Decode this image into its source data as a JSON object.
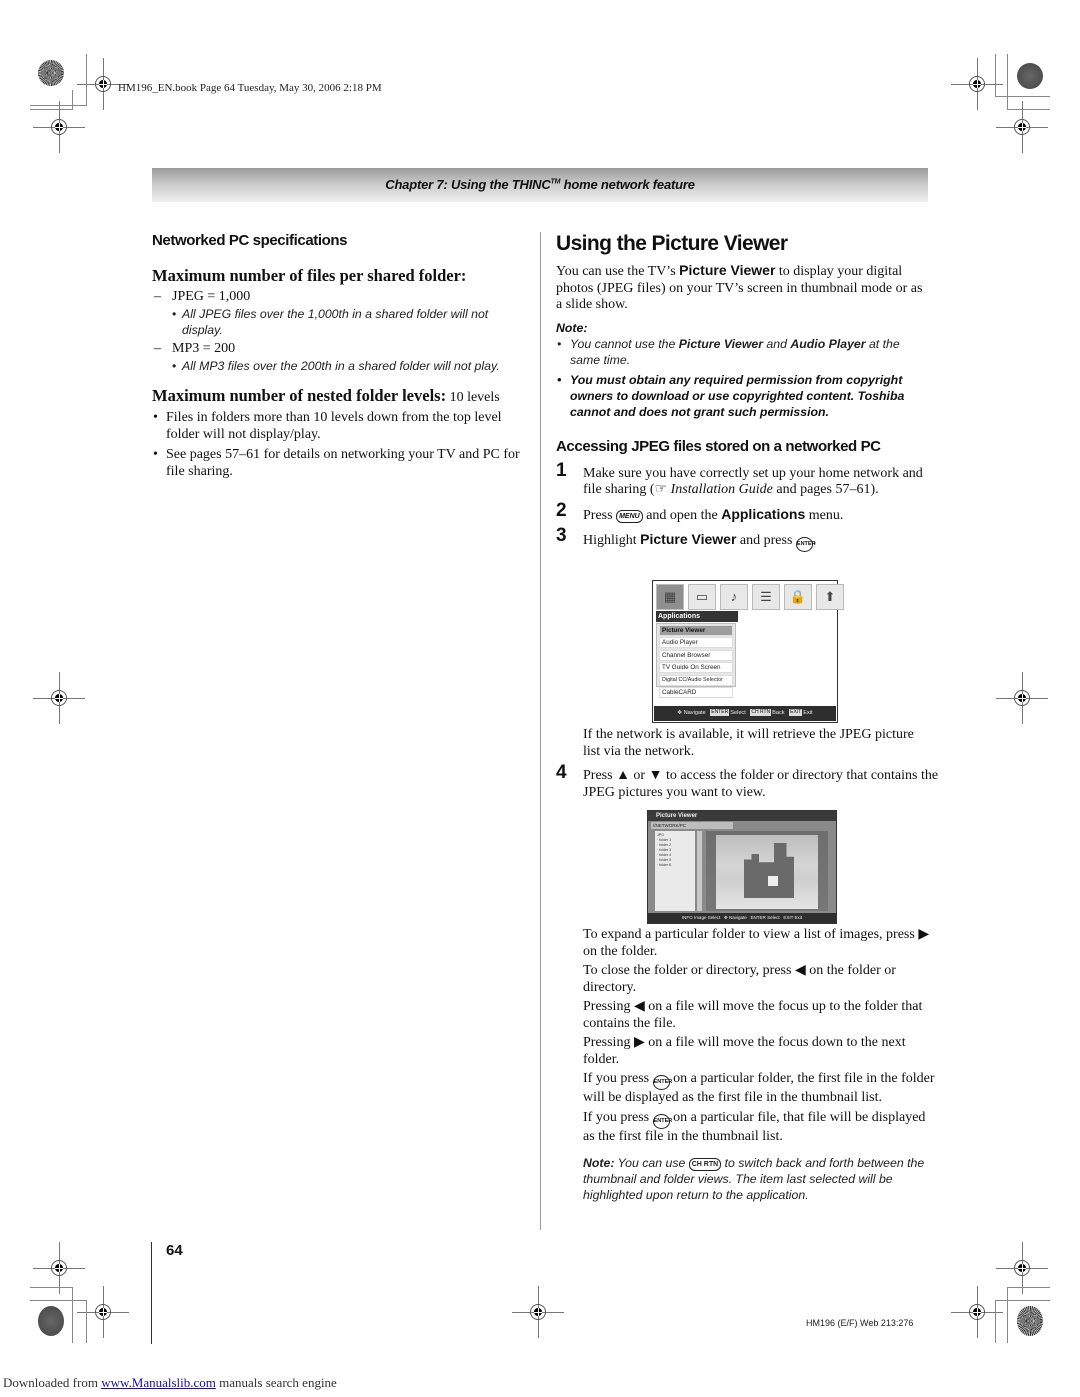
{
  "header": {
    "slug": "HM196_EN.book  Page 64  Tuesday, May 30, 2006  2:18 PM",
    "chapter_title": "Chapter 7: Using the THINC",
    "chapter_tm": "TM",
    "chapter_suffix": " home network feature"
  },
  "left": {
    "section_title": "Networked PC specifications",
    "files_heading": "Maximum number of files per shared folder:",
    "jpeg_line": "JPEG = 1,000",
    "jpeg_note": "All JPEG files over the 1,000th in a shared folder will not display.",
    "mp3_line": "MP3 = 200",
    "mp3_note": "All MP3 files over the 200th in a shared folder will not play.",
    "nested_heading": "Maximum number of nested folder levels:",
    "nested_value": " 10 levels",
    "bullets": [
      "Files in folders more than 10 levels down from the top level folder will not display/play.",
      "See pages 57–61 for details on networking your TV and PC for file sharing."
    ]
  },
  "right": {
    "title": "Using the Picture Viewer",
    "intro_pre": "You can use the TV’s ",
    "intro_bold": "Picture Viewer",
    "intro_post": " to display your digital photos (JPEG files) on your TV’s screen in thumbnail mode or as a slide show.",
    "note_label": "Note:",
    "note1_pre": "You cannot use the ",
    "note1_b1": "Picture Viewer",
    "note1_mid": " and ",
    "note1_b2": "Audio Player",
    "note1_post": " at the same time.",
    "note2": "You must obtain any required permission from copyright owners to download or use copyrighted content. Toshiba cannot and does not grant such permission.",
    "access_title": "Accessing JPEG files stored on a networked PC",
    "steps": [
      {
        "num": "1",
        "pre": "Make sure you have correctly set up your home network and file sharing (",
        "ref_icon": "☞",
        "ref_italic": " Installation Guide",
        "post": " and pages 57–61)."
      },
      {
        "num": "2",
        "pre": "Press ",
        "key": "MENU",
        "mid": " and open the ",
        "bold": "Applications",
        "post": " menu."
      },
      {
        "num": "3",
        "pre": "Highlight ",
        "bold": "Picture Viewer",
        "mid": " and press ",
        "key": "ENTER",
        "post": "."
      },
      {
        "num": "4",
        "pre": "Press ",
        "up": "▲",
        "mid": " or ",
        "down": "▼",
        "post": " to access the folder or directory that contains the JPEG pictures you want to view."
      }
    ],
    "after_step3": "If the network is available, it will retrieve the JPEG picture list via the network.",
    "paras": [
      {
        "pre": "To expand a particular folder to view a list of images, press ",
        "arrow": "▶",
        "post": " on the folder."
      },
      {
        "pre": "To close the folder or directory, press ",
        "arrow": "◀",
        "post": " on the folder or directory."
      },
      {
        "pre": "Pressing ",
        "arrow": "◀",
        "post": " on a file will move the focus up to the folder that contains the file."
      },
      {
        "pre": "Pressing ",
        "arrow": "▶",
        "post": " on a file will move the focus down to the next folder."
      },
      {
        "pre": "If you press ",
        "key": "ENTER",
        "post": " on a particular folder, the first file in the folder will be displayed as the first file in the thumbnail list."
      },
      {
        "pre": "If you press ",
        "key": "ENTER",
        "post": " on a particular file, that file will be displayed as the first file in the thumbnail list."
      }
    ],
    "final_note_label": "Note:",
    "final_note_pre": " You can use ",
    "final_note_key": "CH RTN",
    "final_note_post": " to switch back and forth between the thumbnail and folder views. The item last selected will be highlighted upon return to the application."
  },
  "tv_menu": {
    "icons": [
      "applications-icon",
      "picture-icon",
      "music-icon",
      "settings-icon",
      "lock-icon",
      "setup-icon"
    ],
    "icon_glyphs": [
      "▦",
      "▭",
      "♪",
      "☰",
      "🔒",
      "⬆"
    ],
    "header": "Applications",
    "items": [
      "Picture Viewer",
      "Audio Player",
      "Channel Browser",
      "TV Guide On Screen",
      "Digital CC/Audio Selector",
      "CableCARD"
    ],
    "selected_index": 0,
    "footer": [
      {
        "key": "✥",
        "label": "Navigate"
      },
      {
        "key": "ENTER",
        "label": "Select"
      },
      {
        "key": "CH RTN",
        "label": "Back"
      },
      {
        "key": "EXIT",
        "label": "Exit"
      }
    ]
  },
  "tv_viewer": {
    "title": "Picture Viewer",
    "footer": [
      {
        "key": "INFO",
        "label": "Image Select"
      },
      {
        "key": "✥",
        "label": "Navigate"
      },
      {
        "key": "ENTER",
        "label": "Select"
      },
      {
        "key": "EXIT",
        "label": "Exit"
      }
    ]
  },
  "footer": {
    "page_number": "64",
    "code": "HM196 (E/F) Web 213:276",
    "downloaded_pre": "Downloaded from ",
    "downloaded_link": "www.Manualslib.com",
    "downloaded_post": "  manuals search engine"
  }
}
